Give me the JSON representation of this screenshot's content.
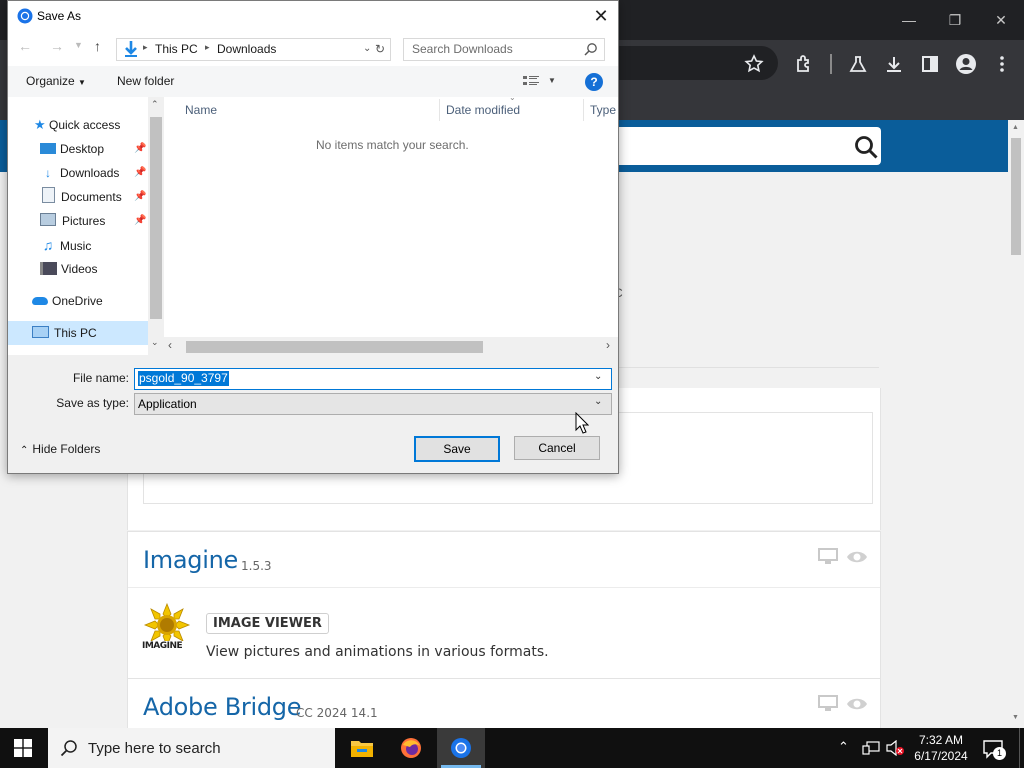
{
  "chrome": {
    "window_controls": [
      "minimize",
      "restore",
      "close"
    ],
    "toolbar_icons": [
      "star-icon",
      "extensions-icon",
      "labs-icon",
      "download-icon",
      "sidepanel-icon",
      "profile-icon",
      "menu-icon"
    ]
  },
  "page": {
    "partial_char": "C",
    "apps": [
      {
        "name": "Imagine",
        "version": "1.5.3",
        "category": "IMAGE VIEWER",
        "description": "View pictures and animations in various formats.",
        "logo_text": "IMAGINE"
      },
      {
        "name": "Adobe Bridge",
        "version": "CC 2024 14.1"
      }
    ]
  },
  "dialog": {
    "title": "Save As",
    "breadcrumb": [
      "This PC",
      "Downloads"
    ],
    "search_placeholder": "Search Downloads",
    "organize_label": "Organize",
    "new_folder_label": "New folder",
    "nav_items": [
      {
        "label": "Quick access",
        "icon": "star-icon",
        "pinned": false
      },
      {
        "label": "Desktop",
        "icon": "desktop-icon",
        "pinned": true
      },
      {
        "label": "Downloads",
        "icon": "downloads-icon",
        "pinned": true
      },
      {
        "label": "Documents",
        "icon": "documents-icon",
        "pinned": true
      },
      {
        "label": "Pictures",
        "icon": "pictures-icon",
        "pinned": true
      },
      {
        "label": "Music",
        "icon": "music-icon",
        "pinned": false
      },
      {
        "label": "Videos",
        "icon": "videos-icon",
        "pinned": false
      },
      {
        "label": "OneDrive",
        "icon": "onedrive-icon",
        "pinned": false
      },
      {
        "label": "This PC",
        "icon": "thispc-icon",
        "pinned": false,
        "selected": true
      }
    ],
    "columns": [
      "Name",
      "Date modified",
      "Type"
    ],
    "empty_message": "No items match your search.",
    "file_name_label": "File name:",
    "file_name_value": "psgold_90_3797",
    "save_type_label": "Save as type:",
    "save_type_value": "Application",
    "hide_folders_label": "Hide Folders",
    "save_label": "Save",
    "cancel_label": "Cancel"
  },
  "taskbar": {
    "search_placeholder": "Type here to search",
    "time": "7:32 AM",
    "date": "6/17/2024",
    "notification_count": "1"
  },
  "colors": {
    "accent": "#0078d7",
    "page_bar": "#0a5d9a",
    "app_title": "#1566a8"
  }
}
